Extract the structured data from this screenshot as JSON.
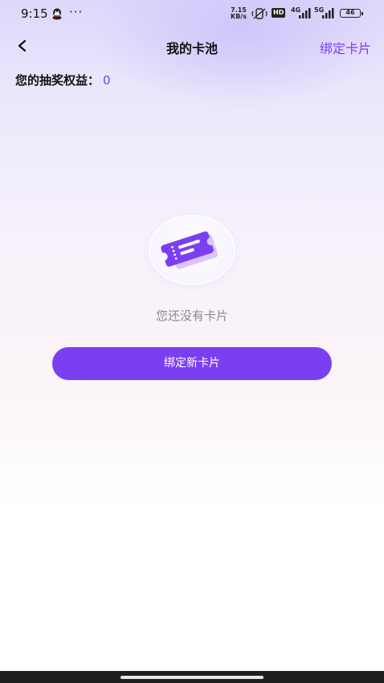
{
  "status_bar": {
    "time": "9:15",
    "dots": "···",
    "net_speed_value": "7.15",
    "net_speed_unit": "KB/s",
    "hd": "HD",
    "sig1": "4G",
    "sig2": "5G",
    "battery": "46",
    "icons": [
      "qq-icon",
      "mute-vibrate-icon",
      "signal-icon",
      "battery-icon"
    ]
  },
  "nav": {
    "back_icon": "chevron-left-icon",
    "title": "我的卡池",
    "action": "绑定卡片"
  },
  "rights": {
    "label": "您的抽奖权益：",
    "value": "0"
  },
  "empty_state": {
    "icon": "ticket-icon",
    "text": "您还没有卡片"
  },
  "bind_button": {
    "label": "绑定新卡片"
  },
  "colors": {
    "accent": "#7b3ff2",
    "muted_text": "#8a8a8a"
  }
}
